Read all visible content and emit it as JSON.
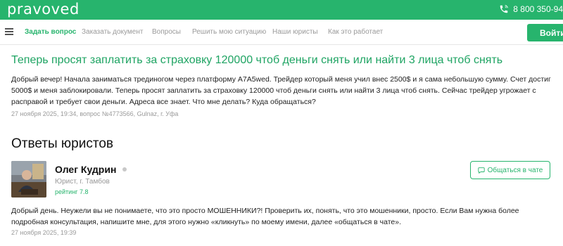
{
  "header": {
    "logo": "pravoved",
    "phone": "8 800 350-94"
  },
  "nav": {
    "items": [
      {
        "label": "Задать вопрос"
      },
      {
        "label": "Заказать документ"
      },
      {
        "label": "Вопросы"
      },
      {
        "label": "Решить мою ситуацию"
      },
      {
        "label": "Наши юристы"
      },
      {
        "label": "Как это работает"
      }
    ],
    "login": "Войти"
  },
  "question": {
    "title": "Теперь просят заплатить за страховку 120000 чтоб деньги снять или найти 3 лица чтоб снять",
    "text": "Добрый вечер! Начала заниматься трединогом через платформу A7A5wed. Трейдер который меня учил внес 2500$ и я сама небольшую сумму. Счет достиг 5000$ и меня заблокировали. Теперь просят заплатить за страховку 120000 чтоб деньги снять или найти 3 лица чтоб снять. Сейчас трейдер угрожает с расправой и требует свои деньги. Адреса все знает. Что мне делать? Куда обращаться?",
    "meta": "27 ноября 2025, 19:34, вопрос №4773566, Gulnaz, г. Уфа"
  },
  "answers": {
    "heading": "Ответы юристов",
    "items": [
      {
        "name": "Олег Кудрин",
        "role": "Юрист, г. Тамбов",
        "rating": "рейтинг 7.8",
        "chat_label": "Общаться в чате",
        "text": "Добрый день. Неужели вы не понимаете, что это просто МОШЕННИКИ?! Проверить их, понять, что это мошенники, просто. Если Вам нужна более подробная консультация, напишите мне, для этого нужно «кликнуть» по моему имени, далее «общаться в чате».",
        "meta": "27 ноября 2025, 19:39"
      }
    ]
  },
  "colors": {
    "brand": "#27b46d",
    "muted": "#9a9a9a"
  },
  "icons": {
    "phone": "phone-icon",
    "menu": "menu-icon",
    "chat": "chat-icon",
    "status": "online-status-icon"
  }
}
